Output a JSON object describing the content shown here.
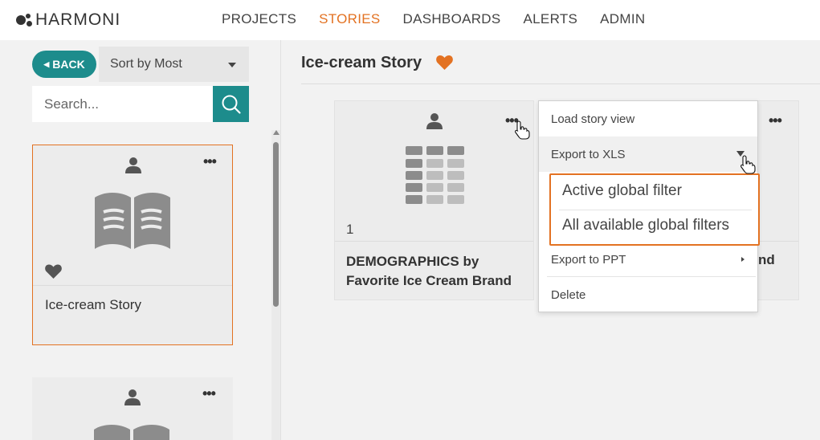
{
  "brand": {
    "name": "HARMONI"
  },
  "nav": {
    "items": [
      {
        "label": "PROJECTS"
      },
      {
        "label": "STORIES"
      },
      {
        "label": "DASHBOARDS"
      },
      {
        "label": "ALERTS"
      },
      {
        "label": "ADMIN"
      }
    ],
    "active": "STORIES"
  },
  "sidebar": {
    "back_label": "BACK",
    "sort_label": "Sort by Most",
    "search_placeholder": "Search...",
    "stories": [
      {
        "title": "Ice-cream Story",
        "favorite": true,
        "selected": true
      },
      {
        "title": "",
        "favorite": false,
        "selected": false
      }
    ]
  },
  "main": {
    "title": "Ice-cream Story",
    "visualizations": [
      {
        "count": "1",
        "title": "DEMOGRAPHICS by Favorite Ice Cream Brand"
      },
      {
        "title_fragment": "nd"
      }
    ]
  },
  "context_menu": {
    "items": [
      {
        "label": "Load story view"
      },
      {
        "label": "Export to XLS"
      },
      {
        "label": "Export to PPT"
      },
      {
        "label": "Delete"
      }
    ],
    "submenu": [
      {
        "label": "Active global filter"
      },
      {
        "label": "All available global filters"
      }
    ]
  },
  "colors": {
    "accent": "#e37222",
    "teal": "#1d8c8c",
    "icon_gray": "#8c8c8c"
  }
}
